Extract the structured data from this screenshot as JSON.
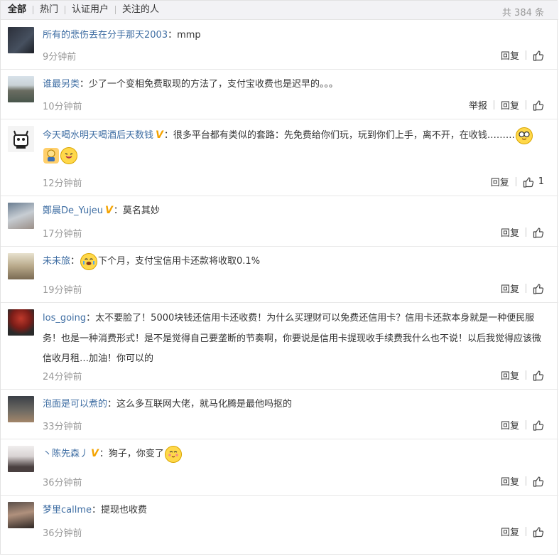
{
  "filters": {
    "tabs": [
      "全部",
      "热门",
      "认证用户",
      "关注的人"
    ],
    "total": "共 384 条"
  },
  "actions": {
    "reply": "回复",
    "report": "举报"
  },
  "comments": [
    {
      "user": "所有的悲伤丢在分手那天2003",
      "verified": false,
      "text": "mmp",
      "text2": "",
      "time": "9分钟前",
      "likes": "",
      "report": false,
      "emoji": []
    },
    {
      "user": "谁最另类",
      "verified": false,
      "text": "少了一个变相免费取现的方法了，支付宝收费也是迟早的。。。",
      "text2": "",
      "time": "10分钟前",
      "likes": "",
      "report": true,
      "emoji": []
    },
    {
      "user": "今天喝水明天喝酒后天数钱",
      "verified": true,
      "text": "很多平台都有类似的套路：先免费给你们玩，玩到你们上手，离不开，在收钱………",
      "text2": "",
      "time": "12分钟前",
      "likes": "1",
      "report": false,
      "emoji": [
        "glasses-face-emoji",
        "praying-emoji",
        "tongue-face-emoji"
      ]
    },
    {
      "user": "鄭晨De_Yujeu",
      "verified": true,
      "text": "莫名其妙",
      "text2": "",
      "time": "17分钟前",
      "likes": "",
      "report": false,
      "emoji": []
    },
    {
      "user": "未未旅",
      "verified": false,
      "text": "",
      "text2": "下个月，支付宝信用卡还款将收取0.1%",
      "time": "19分钟前",
      "likes": "",
      "report": false,
      "emoji": [
        "crying-face-emoji"
      ]
    },
    {
      "user": "los_going",
      "verified": false,
      "text": "太不要脸了！5000块钱还信用卡还收费！为什么买理财可以免费还信用卡？信用卡还款本身就是一种便民服务！也是一种消费形式！是不是觉得自己要垄断的节奏啊，你要说是信用卡提现收手续费我什么也不说！以后我觉得应该微信收月租…加油！你可以的",
      "text2": "",
      "time": "24分钟前",
      "likes": "",
      "report": false,
      "emoji": []
    },
    {
      "user": "泡面是可以煮的",
      "verified": false,
      "text": "这么多互联网大佬，就马化腾是最他吗抠的",
      "text2": "",
      "time": "33分钟前",
      "likes": "",
      "report": false,
      "emoji": []
    },
    {
      "user": "丶陈先森丿",
      "verified": true,
      "text": "狗子，你变了",
      "text2": "",
      "time": "36分钟前",
      "likes": "",
      "report": false,
      "emoji": [
        "blushing-face-emoji"
      ]
    },
    {
      "user": "梦里callme",
      "verified": false,
      "text": "提现也收费",
      "text2": "",
      "time": "36分钟前",
      "likes": "",
      "report": false,
      "emoji": []
    }
  ],
  "colors": {
    "username": "#3f6ea3",
    "verified": "#f4a300",
    "time": "#999999",
    "filter_bg": "#f2f2f5"
  }
}
